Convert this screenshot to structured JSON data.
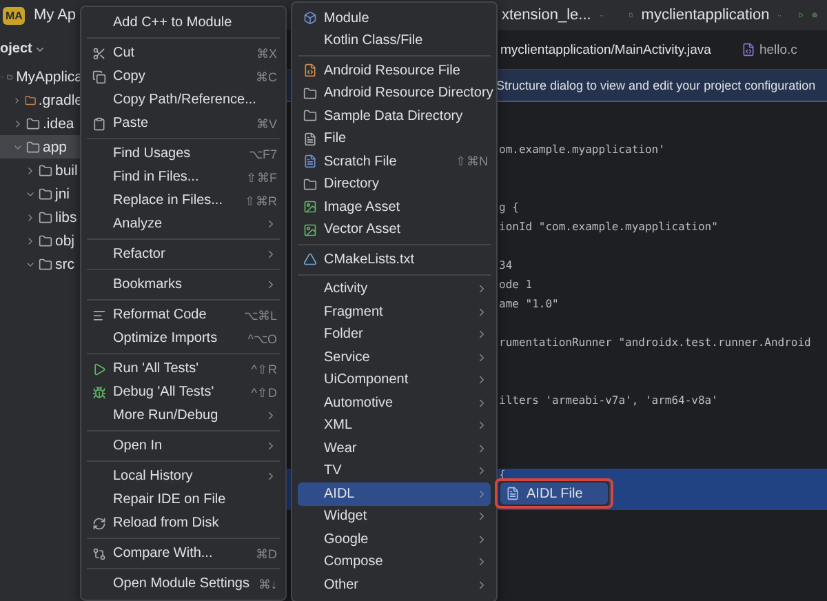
{
  "top_bar": {
    "badge": "MA",
    "project": "My Ap",
    "config": "xtension_le...",
    "run_target": "myclientapplication"
  },
  "project_panel": {
    "title": "oject",
    "tree": [
      {
        "label": "MyApplica",
        "selected": false,
        "expanded": true,
        "children": [
          {
            "label": ".gradle",
            "selected": false,
            "expanded": false
          },
          {
            "label": ".idea",
            "selected": false,
            "expanded": false
          },
          {
            "label": "app",
            "selected": true,
            "expanded": true,
            "children": [
              {
                "label": "buil",
                "selected": false,
                "expanded": false
              },
              {
                "label": "jni",
                "selected": false,
                "expanded": true
              },
              {
                "label": "libs",
                "selected": false,
                "expanded": false
              },
              {
                "label": "obj",
                "selected": false,
                "expanded": false
              },
              {
                "label": "src",
                "selected": false,
                "expanded": true
              }
            ]
          }
        ]
      }
    ]
  },
  "editor": {
    "tabs": [
      {
        "label": "myclientapplication/MainActivity.java",
        "selected": true
      },
      {
        "label": "hello.c",
        "selected": false
      }
    ],
    "banner": "Structure dialog to view and edit your project configuration",
    "lines": [
      {
        "kind": "blank"
      },
      {
        "kind": "blank"
      },
      {
        "kind": "code",
        "text": "om.example.myapplication'",
        "highlighted": false
      },
      {
        "kind": "blank"
      },
      {
        "kind": "blank"
      },
      {
        "kind": "code",
        "text": "g {",
        "highlighted": false
      },
      {
        "kind": "code",
        "text": "ionId \"com.example.myapplication\"",
        "highlighted": false
      },
      {
        "kind": "blank"
      },
      {
        "kind": "code",
        "text": "34",
        "highlighted": false
      },
      {
        "kind": "code",
        "text": "ode 1",
        "highlighted": false
      },
      {
        "kind": "code",
        "text": "ame \"1.0\"",
        "highlighted": false
      },
      {
        "kind": "blank"
      },
      {
        "kind": "code",
        "text": "rumentationRunner \"androidx.test.runner.Android",
        "highlighted": false
      },
      {
        "kind": "blank"
      },
      {
        "kind": "blank"
      },
      {
        "kind": "code",
        "text": "ilters 'armeabi-v7a', 'arm64-v8a'",
        "highlighted": false
      },
      {
        "kind": "blank"
      },
      {
        "kind": "blank"
      },
      {
        "kind": "blank"
      },
      {
        "kind": "code",
        "text": "{",
        "highlighted": true
      }
    ]
  },
  "context_menu": [
    {
      "kind": "item",
      "label": "Add C++ to Module"
    },
    {
      "kind": "separator"
    },
    {
      "kind": "item",
      "label": "Cut",
      "shortcut": "⌘X"
    },
    {
      "kind": "item",
      "label": "Copy",
      "shortcut": "⌘C"
    },
    {
      "kind": "item",
      "label": "Copy Path/Reference..."
    },
    {
      "kind": "item",
      "label": "Paste",
      "shortcut": "⌘V"
    },
    {
      "kind": "separator"
    },
    {
      "kind": "item",
      "label": "Find Usages",
      "shortcut": "⌥F7"
    },
    {
      "kind": "item",
      "label": "Find in Files...",
      "shortcut": "⇧⌘F"
    },
    {
      "kind": "item",
      "label": "Replace in Files...",
      "shortcut": "⇧⌘R"
    },
    {
      "kind": "submenu",
      "label": "Analyze"
    },
    {
      "kind": "separator"
    },
    {
      "kind": "submenu",
      "label": "Refactor"
    },
    {
      "kind": "separator"
    },
    {
      "kind": "submenu",
      "label": "Bookmarks"
    },
    {
      "kind": "separator"
    },
    {
      "kind": "item",
      "label": "Reformat Code",
      "shortcut": "⌥⌘L"
    },
    {
      "kind": "item",
      "label": "Optimize Imports",
      "shortcut": "^⌥O"
    },
    {
      "kind": "separator"
    },
    {
      "kind": "item",
      "label": "Run 'All Tests'",
      "shortcut": "^⇧R"
    },
    {
      "kind": "item",
      "label": "Debug 'All Tests'",
      "shortcut": "^⇧D"
    },
    {
      "kind": "submenu",
      "label": "More Run/Debug"
    },
    {
      "kind": "separator"
    },
    {
      "kind": "submenu",
      "label": "Open In"
    },
    {
      "kind": "separator"
    },
    {
      "kind": "submenu",
      "label": "Local History"
    },
    {
      "kind": "item",
      "label": "Repair IDE on File"
    },
    {
      "kind": "item",
      "label": "Reload from Disk"
    },
    {
      "kind": "separator"
    },
    {
      "kind": "item",
      "label": "Compare With...",
      "shortcut": "⌘D"
    },
    {
      "kind": "separator"
    },
    {
      "kind": "item",
      "label": "Open Module Settings",
      "shortcut": "⌘↓"
    }
  ],
  "new_menu": [
    {
      "kind": "item",
      "label": "Module",
      "selected": false
    },
    {
      "kind": "item",
      "label": "Kotlin Class/File",
      "selected": false
    },
    {
      "kind": "separator"
    },
    {
      "kind": "item",
      "label": "Android Resource File",
      "selected": false
    },
    {
      "kind": "item",
      "label": "Android Resource Directory",
      "selected": false
    },
    {
      "kind": "item",
      "label": "Sample Data Directory",
      "selected": false
    },
    {
      "kind": "item",
      "label": "File",
      "selected": false
    },
    {
      "kind": "item",
      "label": "Scratch File",
      "shortcut": "⇧⌘N",
      "selected": false
    },
    {
      "kind": "item",
      "label": "Directory",
      "selected": false
    },
    {
      "kind": "item",
      "label": "Image Asset",
      "selected": false
    },
    {
      "kind": "item",
      "label": "Vector Asset",
      "selected": false
    },
    {
      "kind": "separator"
    },
    {
      "kind": "item",
      "label": "CMakeLists.txt",
      "selected": false
    },
    {
      "kind": "separator"
    },
    {
      "kind": "submenu",
      "label": "Activity",
      "selected": false
    },
    {
      "kind": "submenu",
      "label": "Fragment",
      "selected": false
    },
    {
      "kind": "submenu",
      "label": "Folder",
      "selected": false
    },
    {
      "kind": "submenu",
      "label": "Service",
      "selected": false
    },
    {
      "kind": "submenu",
      "label": "UiComponent",
      "selected": false
    },
    {
      "kind": "submenu",
      "label": "Automotive",
      "selected": false
    },
    {
      "kind": "submenu",
      "label": "XML",
      "selected": false
    },
    {
      "kind": "submenu",
      "label": "Wear",
      "selected": false
    },
    {
      "kind": "submenu",
      "label": "TV",
      "selected": false
    },
    {
      "kind": "submenu",
      "label": "AIDL",
      "selected": true
    },
    {
      "kind": "submenu",
      "label": "Widget",
      "selected": false
    },
    {
      "kind": "submenu",
      "label": "Google",
      "selected": false
    },
    {
      "kind": "submenu",
      "label": "Compose",
      "selected": false
    },
    {
      "kind": "submenu",
      "label": "Other",
      "selected": false
    }
  ],
  "aidl_menu": [
    {
      "kind": "item",
      "label": "AIDL File",
      "selected": true
    }
  ]
}
